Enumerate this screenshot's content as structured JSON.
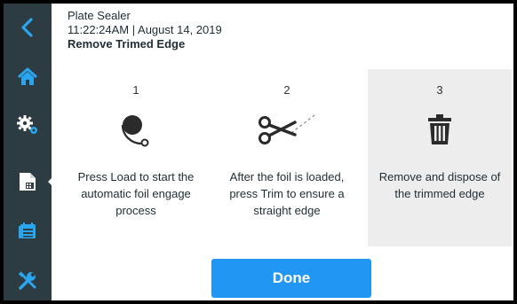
{
  "header": {
    "app_name": "Plate Sealer",
    "datetime": "11:22:24AM | August 14, 2019",
    "page_title": "Remove Trimed Edge"
  },
  "sidebar": {
    "items": [
      {
        "icon": "chevron-left-icon",
        "active": false
      },
      {
        "icon": "home-icon",
        "active": false
      },
      {
        "icon": "gears-icon",
        "active": false
      },
      {
        "icon": "document-icon",
        "active": true
      },
      {
        "icon": "calendar-icon",
        "active": false
      },
      {
        "icon": "tools-icon",
        "active": false
      }
    ]
  },
  "steps": [
    {
      "number": "1",
      "icon": "foil-roll-icon",
      "text": "Press Load to start the automatic foil engage process",
      "highlighted": false
    },
    {
      "number": "2",
      "icon": "scissors-icon",
      "text": "After the foil is loaded, press Trim to ensure a straight edge",
      "highlighted": false
    },
    {
      "number": "3",
      "icon": "trash-icon",
      "text": "Remove and dispose of the trimmed edge",
      "highlighted": true
    }
  ],
  "actions": {
    "done_label": "Done"
  },
  "colors": {
    "sidebar_bg": "#2d3b43",
    "accent": "#2196f3",
    "highlight_bg": "#ededed"
  }
}
